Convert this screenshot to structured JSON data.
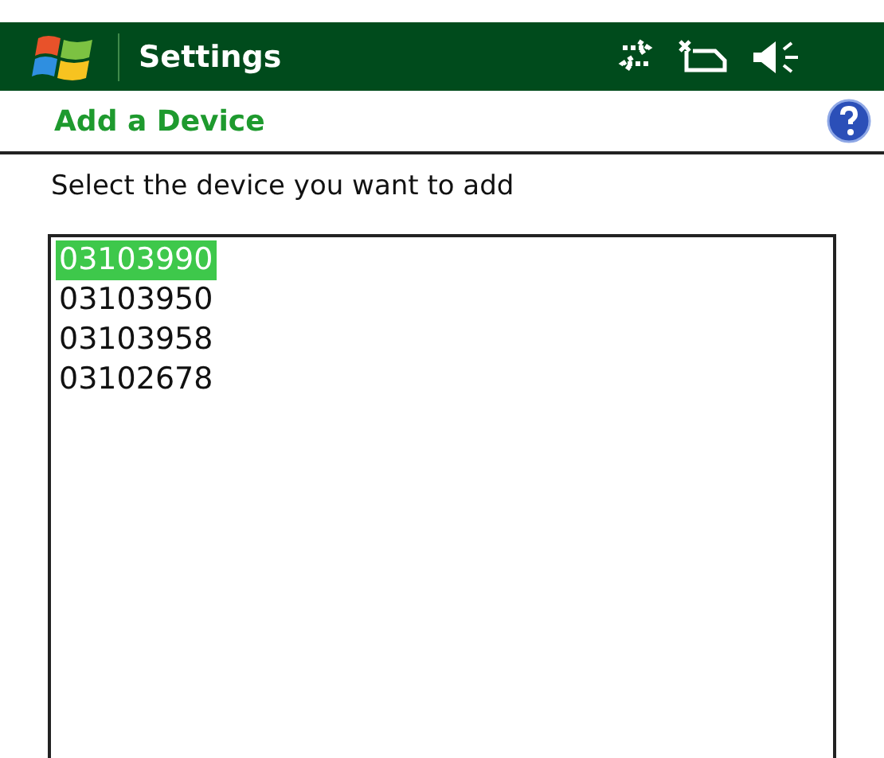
{
  "title_bar": {
    "title": "Settings"
  },
  "header": {
    "title": "Add a Device"
  },
  "instruction": "Select the device you want to add",
  "devices": [
    {
      "label": "03103990",
      "selected": true
    },
    {
      "label": "03103950",
      "selected": false
    },
    {
      "label": "03103958",
      "selected": false
    },
    {
      "label": "03102678",
      "selected": false
    }
  ]
}
